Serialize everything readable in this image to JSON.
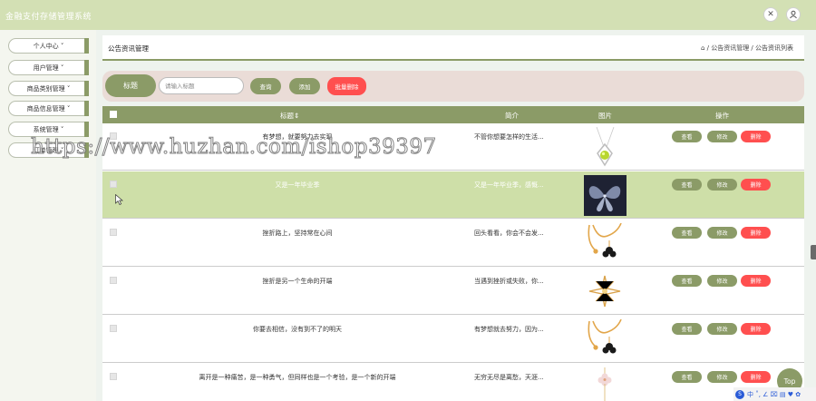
{
  "app": {
    "title": "金融支付存储管理系统"
  },
  "header_icons": [
    "fullscreen-icon",
    "user-icon"
  ],
  "sidebar": {
    "items": [
      {
        "label": "个人中心 ˅"
      },
      {
        "label": "用户管理 ˅"
      },
      {
        "label": "商品类别管理 ˅"
      },
      {
        "label": "商品信息管理 ˅"
      },
      {
        "label": "系统管理 ˅"
      },
      {
        "label": "订单管理 ˅"
      }
    ]
  },
  "page": {
    "title": "公告资讯管理",
    "breadcrumb": "⌂ / 公告资讯管理 / 公告资讯列表"
  },
  "search": {
    "label": "标题",
    "placeholder": "请输入标题",
    "query_button": "查询",
    "add_button": "添加",
    "batch_delete_button": "批量删除"
  },
  "table": {
    "columns": {
      "title": "标题⇕",
      "intro": "简介",
      "image": "图片",
      "actions": "操作"
    },
    "action_labels": {
      "view": "查看",
      "edit": "修改",
      "delete": "删除"
    },
    "rows": [
      {
        "title": "有梦想，就要努力去实现",
        "intro": "不管你想要怎样的生活...",
        "image": "pendant-green-gem"
      },
      {
        "title": "又是一年毕业季",
        "intro": "又是一年毕业季，感慨...",
        "image": "butterfly-brooch"
      },
      {
        "title": "挫折路上，坚持常在心间",
        "intro": "回头看看，你会不会发...",
        "image": "gold-chain-necklace"
      },
      {
        "title": "挫折是另一个生命的开端",
        "intro": "当遇到挫折或失败，你...",
        "image": "star-brooch"
      },
      {
        "title": "你要去相信，没有到不了的明天",
        "intro": "有梦想就去努力，因为...",
        "image": "gold-chain-necklace"
      },
      {
        "title": "离开是一种痛苦，是一种勇气，但同样也是一个考验，是一个新的开端",
        "intro": "无穷无尽是离愁，天涯...",
        "image": "flower-necklace"
      }
    ]
  },
  "widgets": {
    "top_button": "Top"
  },
  "tray": {
    "text": "中 ˚, ∠ ⌧ ▤ ♥ ✿"
  },
  "watermark": {
    "text": "https://www.huzhan.com/ishop39397"
  },
  "colors": {
    "accent": "#8b9b67",
    "topbar": "#d3e0b4",
    "danger": "#ff4f4f",
    "highlight_row": "#cedfa8"
  }
}
